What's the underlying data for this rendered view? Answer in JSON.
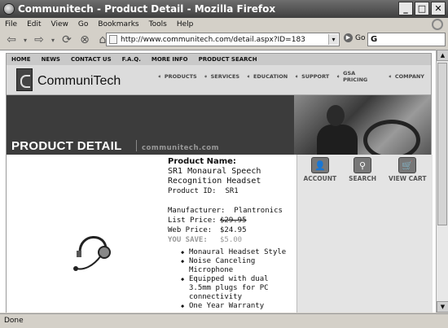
{
  "window": {
    "title": "Communitech - Product Detail - Mozilla Firefox"
  },
  "menu": [
    "File",
    "Edit",
    "View",
    "Go",
    "Bookmarks",
    "Tools",
    "Help"
  ],
  "toolbar": {
    "url": "http://www.communitech.com/detail.aspx?ID=183",
    "go_label": "Go",
    "search_glyph": "G"
  },
  "site": {
    "topnav": [
      "HOME",
      "NEWS",
      "CONTACT US",
      "F.A.Q.",
      "MORE INFO",
      "PRODUCT SEARCH"
    ],
    "logo_text": "CommuniTech",
    "sitenav": [
      "PRODUCTS",
      "SERVICES",
      "EDUCATION",
      "SUPPORT",
      "GSA PRICING",
      "COMPANY"
    ],
    "banner_title": "PRODUCT DETAIL",
    "banner_domain": "communitech.com"
  },
  "product": {
    "name_label": "Product Name:",
    "name": "SR1 Monaural Speech Recognition Headset",
    "id_label": "Product ID:",
    "id": "SR1",
    "manufacturer_label": "Manufacturer:",
    "manufacturer": "Plantronics",
    "list_price_label": "List Price:",
    "list_price": "$29.95",
    "web_price_label": "Web Price:",
    "web_price": "$24.95",
    "you_save_label": "YOU SAVE:",
    "you_save": "$5.00",
    "features": [
      "Monaural Headset Style",
      "Noise Canceling Microphone",
      "Equipped with dual 3.5mm plugs for PC connectivity",
      "One Year Warranty"
    ]
  },
  "actions": [
    "ACCOUNT",
    "SEARCH",
    "VIEW CART"
  ],
  "status": "Done"
}
